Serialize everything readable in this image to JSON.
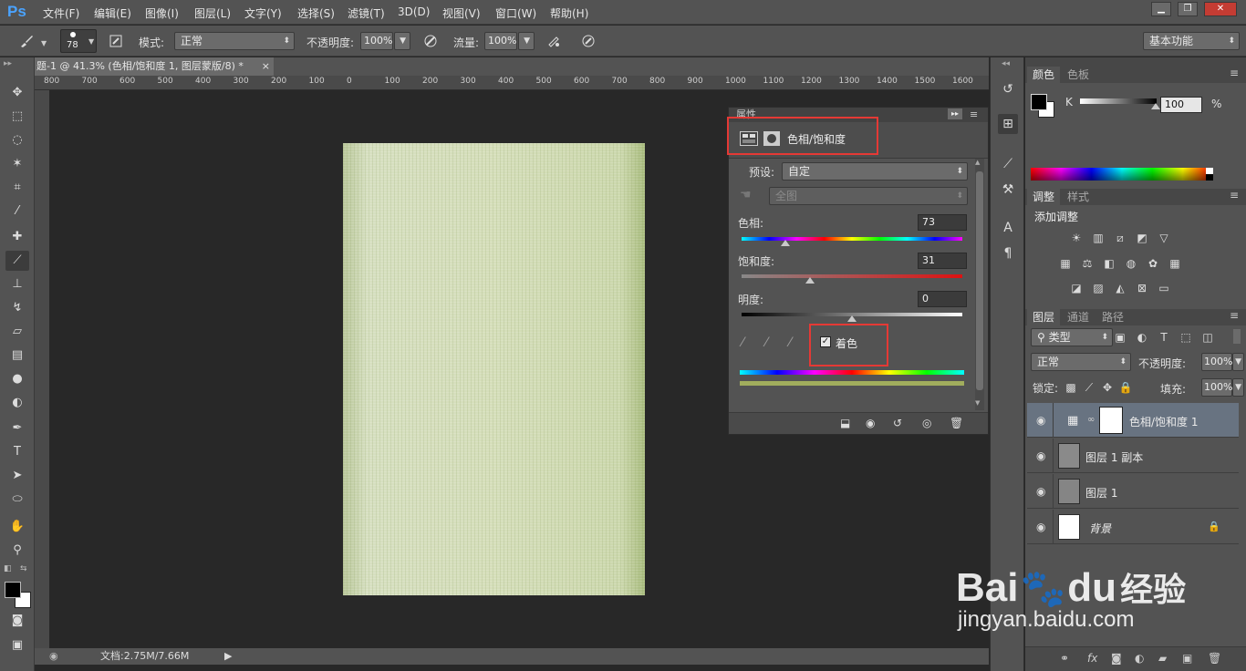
{
  "app": {
    "logo": "Ps"
  },
  "menu": [
    "文件(F)",
    "编辑(E)",
    "图像(I)",
    "图层(L)",
    "文字(Y)",
    "选择(S)",
    "滤镜(T)",
    "3D(D)",
    "视图(V)",
    "窗口(W)",
    "帮助(H)"
  ],
  "window_buttons": [
    "▁",
    "❐",
    "✕"
  ],
  "options": {
    "brush_size": "78",
    "mode_label": "模式:",
    "mode_value": "正常",
    "opacity_label": "不透明度:",
    "opacity_value": "100%",
    "flow_label": "流量:",
    "flow_value": "100%",
    "workspace": "基本功能"
  },
  "document": {
    "tab_title": "题-1 @ 41.3% (色相/饱和度 1, 图层蒙版/8) *",
    "close": "×",
    "status": "文档:2.75M/7.66M"
  },
  "ruler_ticks": [
    "800",
    "700",
    "600",
    "500",
    "400",
    "300",
    "200",
    "100",
    "0",
    "100",
    "200",
    "300",
    "400",
    "500",
    "600",
    "700",
    "800",
    "900",
    "1000",
    "1100",
    "1200",
    "1300",
    "1400",
    "1500",
    "1600"
  ],
  "properties": {
    "panel_title": "属性",
    "adjustment_name": "色相/饱和度",
    "preset_label": "预设:",
    "preset_value": "自定",
    "channel_value": "全图",
    "hue_label": "色相:",
    "hue_value": "73",
    "saturation_label": "饱和度:",
    "saturation_value": "31",
    "lightness_label": "明度:",
    "lightness_value": "0",
    "colorize_label": "着色",
    "colorize_checked": true,
    "colorize_swatch": "#a1ad5d",
    "hue_position": 0.2,
    "saturation_position": 0.31,
    "lightness_position": 0.5
  },
  "color_panel": {
    "tabs": [
      "颜色",
      "色板"
    ],
    "channel_label": "K",
    "value": "100",
    "unit": "%"
  },
  "adjust_panel": {
    "tabs": [
      "调整",
      "样式"
    ],
    "title": "添加调整"
  },
  "layers_panel": {
    "tabs": [
      "图层",
      "通道",
      "路径"
    ],
    "filter": "类型",
    "blend_mode": "正常",
    "opacity_label": "不透明度:",
    "opacity_value": "100%",
    "lock_label": "锁定:",
    "fill_label": "填充:",
    "fill_value": "100%",
    "layers": [
      {
        "name": "色相/饱和度 1"
      },
      {
        "name": "图层 1 副本"
      },
      {
        "name": "图层 1"
      },
      {
        "name": "背景"
      }
    ]
  },
  "watermark": {
    "brand": "Bai",
    "brand2": "du",
    "cn": "经验",
    "url": "jingyan.baidu.com"
  }
}
